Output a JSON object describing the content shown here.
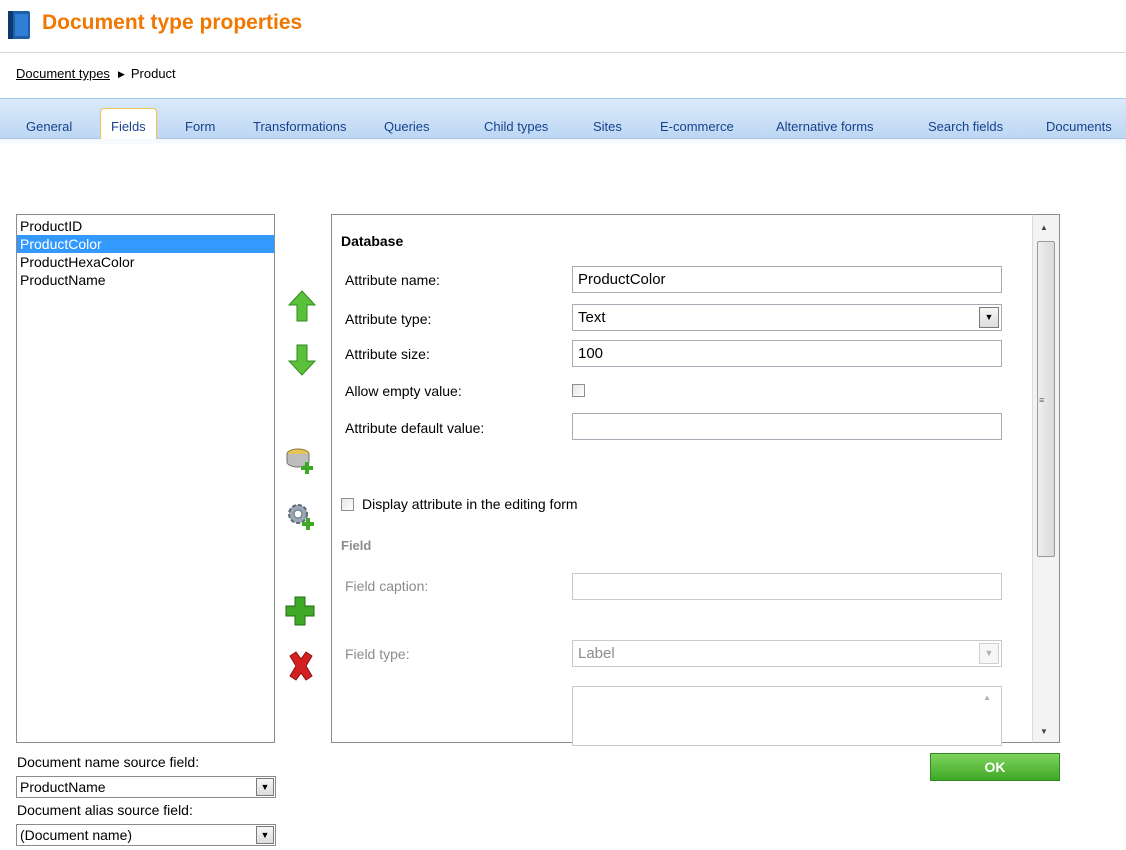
{
  "header": {
    "title": "Document type properties"
  },
  "breadcrumb": {
    "link": "Document types",
    "current": "Product"
  },
  "tabs": [
    "General",
    "Fields",
    "Form",
    "Transformations",
    "Queries",
    "Child types",
    "Sites",
    "E-commerce",
    "Alternative forms",
    "Search fields",
    "Documents"
  ],
  "active_tab": "Fields",
  "fields": {
    "items": [
      "ProductID",
      "ProductColor",
      "ProductHexaColor",
      "ProductName"
    ],
    "selected": "ProductColor"
  },
  "toolbar": {
    "move_up": "arrow-up-icon",
    "move_down": "arrow-down-icon",
    "new_db_attribute": "database-add-icon",
    "new_system_attribute": "gear-add-icon",
    "new_attribute": "plus-icon",
    "delete": "delete-x-icon"
  },
  "database": {
    "heading": "Database",
    "attr_name_label": "Attribute name:",
    "attr_name_value": "ProductColor",
    "attr_type_label": "Attribute type:",
    "attr_type_value": "Text",
    "attr_size_label": "Attribute size:",
    "attr_size_value": "100",
    "allow_empty_label": "Allow empty value:",
    "allow_empty_checked": false,
    "default_value_label": "Attribute default value:",
    "default_value": ""
  },
  "display_in_form": {
    "label": "Display attribute in the editing form",
    "checked": false
  },
  "field": {
    "heading": "Field",
    "caption_label": "Field caption:",
    "caption_value": "",
    "type_label": "Field type:",
    "type_value": "Label"
  },
  "bottom": {
    "name_source_label": "Document name source field:",
    "name_source_value": "ProductName",
    "alias_source_label": "Document alias source field:",
    "alias_source_value": "(Document name)"
  },
  "ok_label": "OK",
  "colors": {
    "title": "#f07800",
    "accent": "#3399ff",
    "ok": "#3fa826"
  }
}
